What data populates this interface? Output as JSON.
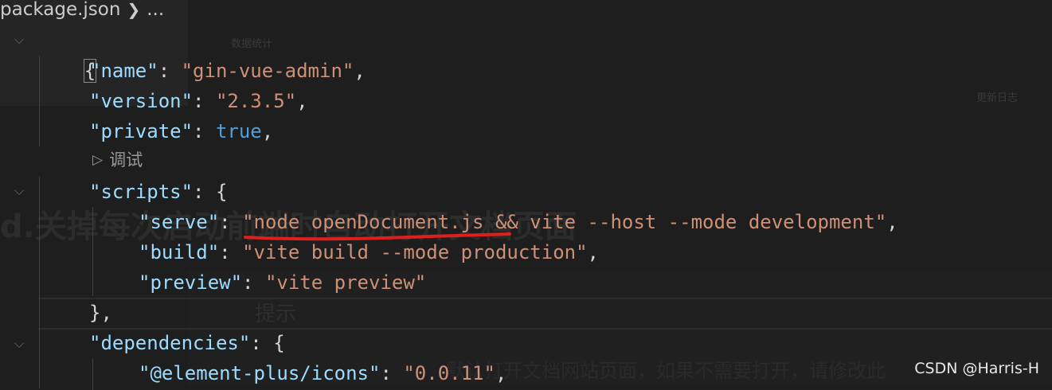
{
  "breadcrumb": {
    "file": "package.json",
    "ellipsis": "..."
  },
  "codelens": {
    "label": "调试"
  },
  "code": {
    "open_brace": "{",
    "name_key": "\"name\"",
    "name_val": "\"gin-vue-admin\"",
    "version_key": "\"version\"",
    "version_val": "\"2.3.5\"",
    "private_key": "\"private\"",
    "private_val": "true",
    "scripts_key": "\"scripts\"",
    "serve_key": "\"serve\"",
    "serve_val": "\"node openDocument.js && vite --host --mode development\"",
    "build_key": "\"build\"",
    "build_val": "\"vite build --mode production\"",
    "preview_key": "\"preview\"",
    "preview_val": "\"vite preview\"",
    "close_scripts": "},",
    "dependencies_key": "\"dependencies\"",
    "icons_key": "\"@element-plus/icons\"",
    "icons_val": "\"0.0.11\""
  },
  "background_ghost": {
    "small_a": "数据统计",
    "small_b": "更新日志",
    "heading": "d.关掉每次启动前端时自动打开文档页面",
    "tip": "提示",
    "note": "默认打开文档网站页面，如果不需要打开，请修改此"
  },
  "watermark": "CSDN @Harris-H",
  "colors": {
    "background": "#1e1e1e",
    "key": "#9cdcfe",
    "string": "#ce9178",
    "keyword": "#569cd6",
    "annotation_underline": "#e01e1e"
  }
}
